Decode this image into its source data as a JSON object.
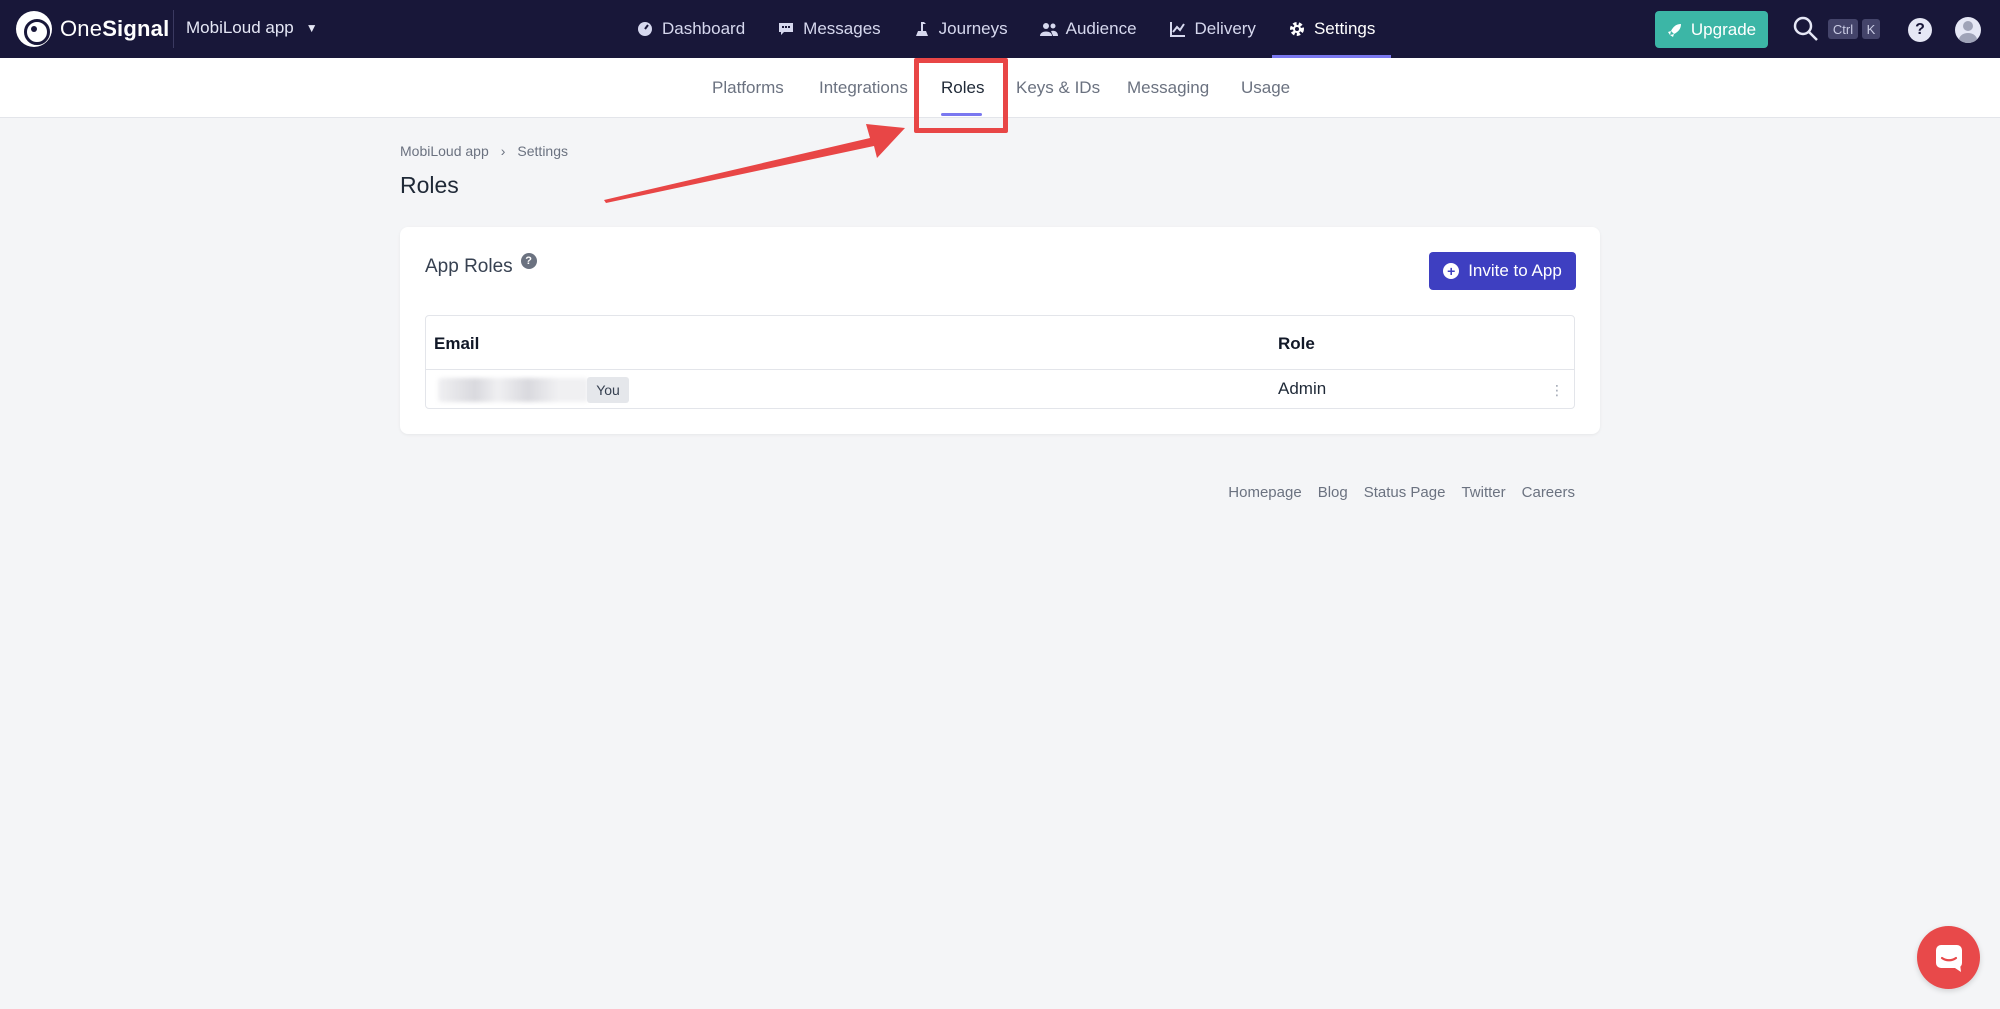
{
  "brand": {
    "name_light": "One",
    "name_bold": "Signal"
  },
  "app_switcher": {
    "label": "MobiLoud app",
    "caret": "▼"
  },
  "main_nav": [
    {
      "label": "Dashboard",
      "icon": "gauge-icon"
    },
    {
      "label": "Messages",
      "icon": "message-icon"
    },
    {
      "label": "Journeys",
      "icon": "journey-icon"
    },
    {
      "label": "Audience",
      "icon": "users-icon"
    },
    {
      "label": "Delivery",
      "icon": "chart-icon"
    },
    {
      "label": "Settings",
      "icon": "gear-icon",
      "active": true
    }
  ],
  "header_actions": {
    "upgrade_label": "Upgrade",
    "shortcut_ctrl": "Ctrl",
    "shortcut_key": "K",
    "help": "?"
  },
  "sub_nav": [
    {
      "label": "Platforms"
    },
    {
      "label": "Integrations"
    },
    {
      "label": "Roles",
      "active": true
    },
    {
      "label": "Keys & IDs"
    },
    {
      "label": "Messaging"
    },
    {
      "label": "Usage"
    }
  ],
  "breadcrumb": {
    "app": "MobiLoud app",
    "sep": "›",
    "section": "Settings"
  },
  "page_title": "Roles",
  "card": {
    "title": "App Roles",
    "help": "?",
    "invite_label": "Invite to App",
    "table": {
      "columns": [
        "Email",
        "Role"
      ],
      "rows": [
        {
          "email_badge": "You",
          "role": "Admin"
        }
      ]
    }
  },
  "footer": [
    "Homepage",
    "Blog",
    "Status Page",
    "Twitter",
    "Careers"
  ],
  "colors": {
    "nav_bg": "#181739",
    "accent": "#7a78f0",
    "upgrade": "#3cb6a6",
    "primary_button": "#3e3fc1",
    "annotation": "#e84646",
    "chat": "#e8494a"
  }
}
